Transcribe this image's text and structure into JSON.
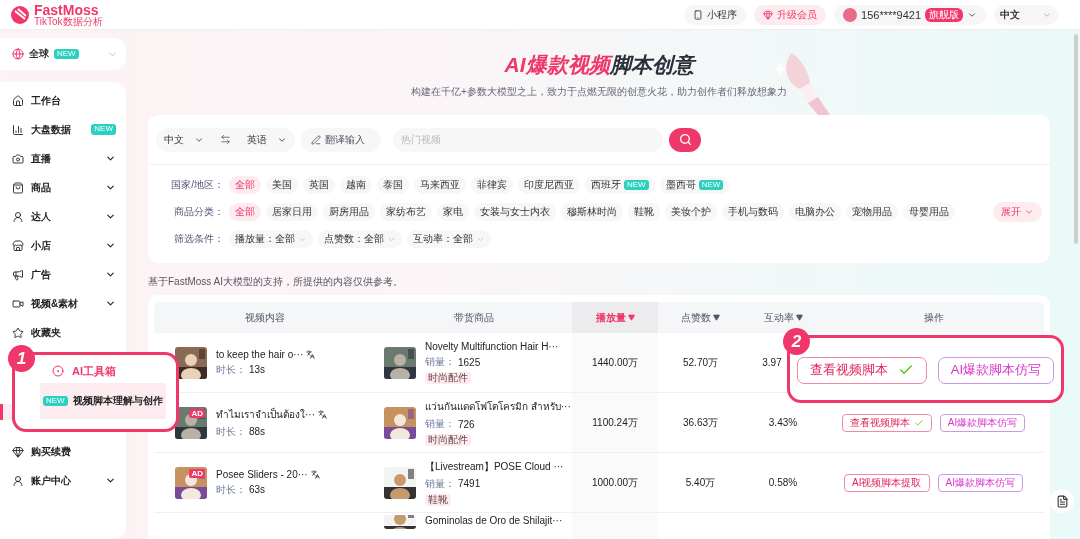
{
  "header": {
    "logo": {
      "name": "FastMoss",
      "tagline": "TikTok数据分析"
    },
    "mini_program": "小程序",
    "upgrade": "升级会员",
    "user": {
      "phone": "156****9421",
      "badge": "旗舰版"
    },
    "language": "中文"
  },
  "sidebar": {
    "region": {
      "label": "全球",
      "badge": "NEW"
    },
    "items": [
      {
        "label": "工作台",
        "expandable": false
      },
      {
        "label": "大盘数据",
        "badge": "NEW",
        "expandable": false
      },
      {
        "label": "直播",
        "expandable": true
      },
      {
        "label": "商品",
        "expandable": true
      },
      {
        "label": "达人",
        "expandable": true
      },
      {
        "label": "小店",
        "expandable": true
      },
      {
        "label": "广告",
        "expandable": true
      },
      {
        "label": "视频&素材",
        "expandable": true
      },
      {
        "label": "收藏夹",
        "expandable": false
      }
    ],
    "bottom_items": [
      {
        "label": "购买续费",
        "expandable": false
      },
      {
        "label": "账户中心",
        "expandable": true
      }
    ]
  },
  "hero": {
    "title_highlight": "AI爆款视频",
    "title_rest": "脚本创意",
    "subtitle": "构建在千亿+参数大模型之上，致力于点燃无限的创意火花，助力创作者们释放想象力"
  },
  "search": {
    "source_language": "中文",
    "target_language": "英语",
    "translate_input": "翻译输入",
    "placeholder": "热门视频"
  },
  "filters": [
    {
      "label": "国家/地区：",
      "chips": [
        {
          "label": "全部",
          "selected": true
        },
        {
          "label": "美国",
          "selected": false
        },
        {
          "label": "英国",
          "selected": false
        },
        {
          "label": "越南",
          "selected": false
        },
        {
          "label": "泰国",
          "selected": false
        },
        {
          "label": "马来西亚",
          "selected": false
        },
        {
          "label": "菲律宾",
          "selected": false
        },
        {
          "label": "印度尼西亚",
          "selected": false
        },
        {
          "label": "西班牙",
          "selected": false,
          "badge": "NEW"
        },
        {
          "label": "墨西哥",
          "selected": false,
          "badge": "NEW"
        }
      ]
    },
    {
      "label": "商品分类：",
      "chips": [
        {
          "label": "全部",
          "selected": true
        },
        {
          "label": "居家日用",
          "selected": false
        },
        {
          "label": "厨房用品",
          "selected": false
        },
        {
          "label": "家纺布艺",
          "selected": false
        },
        {
          "label": "家电",
          "selected": false
        },
        {
          "label": "女装与女士内衣",
          "selected": false
        },
        {
          "label": "穆斯林时尚",
          "selected": false
        },
        {
          "label": "鞋靴",
          "selected": false
        },
        {
          "label": "美妆个护",
          "selected": false
        },
        {
          "label": "手机与数码",
          "selected": false
        },
        {
          "label": "电脑办公",
          "selected": false
        },
        {
          "label": "宠物用品",
          "selected": false
        },
        {
          "label": "母婴用品",
          "selected": false
        }
      ],
      "more": "展开"
    }
  ],
  "conditions": {
    "label": "筛选条件：",
    "dropdowns": [
      "播放量：全部",
      "点赞数：全部",
      "互动率：全部"
    ]
  },
  "disclaimer": "基于FastMoss AI大模型的支持，所提供的内容仅供参考。",
  "table": {
    "columns": [
      {
        "label": "视频内容",
        "sortable": false,
        "selected": false
      },
      {
        "label": "带货商品",
        "sortable": false,
        "selected": false
      },
      {
        "label": "播放量",
        "sortable": true,
        "selected": true
      },
      {
        "label": "点赞数",
        "sortable": true,
        "selected": false
      },
      {
        "label": "互动率",
        "sortable": true,
        "selected": false
      },
      {
        "label": "操作",
        "sortable": false,
        "selected": false
      }
    ],
    "rows": [
      {
        "video": {
          "title": "to keep the hair o···",
          "duration_label": "时长：",
          "duration": "13s"
        },
        "product": {
          "title": "Novelty Multifunction Hair H···",
          "sales_label": "销量：",
          "sales": "1625",
          "tag": "时尚配件"
        },
        "plays": "1440.00万",
        "likes": "52.70万",
        "rate": "3.97",
        "actions": []
      },
      {
        "video": {
          "title": "ทำไมเราจำเป็นต้องใ···",
          "duration_label": "时长：",
          "duration": "88s",
          "ad_label": "AD"
        },
        "product": {
          "title": "แว่นกันแดดโฟโตโครมิก สำหรับ···",
          "sales_label": "销量：",
          "sales": "726",
          "tag": "时尚配件"
        },
        "plays": "1100.24万",
        "likes": "36.63万",
        "rate": "3.43%",
        "actions": [
          {
            "label": "查看视频脚本",
            "checked": true,
            "kind": "script"
          },
          {
            "label": "AI爆款脚本仿写",
            "checked": false,
            "kind": "imitate"
          }
        ]
      },
      {
        "video": {
          "title": "Posee Sliders - 20···",
          "duration_label": "时长：",
          "duration": "63s",
          "ad_label": "AD"
        },
        "product": {
          "title": "【Livestream】POSE Cloud ···",
          "sales_label": "销量：",
          "sales": "7491",
          "tag": "鞋靴"
        },
        "plays": "1000.00万",
        "likes": "5.40万",
        "rate": "0.58%",
        "actions": [
          {
            "label": "AI视频脚本提取",
            "checked": false,
            "kind": "script"
          },
          {
            "label": "AI爆款脚本仿写",
            "checked": false,
            "kind": "imitate"
          }
        ]
      },
      {
        "product": {
          "title": "Gominolas de Oro de Shilajit···"
        }
      }
    ]
  },
  "callouts": [
    {
      "number": "1",
      "menu_title": "AI工具箱",
      "item_badge": "NEW",
      "item_label": "视频脚本理解与创作"
    },
    {
      "number": "2",
      "actions": [
        {
          "label": "查看视频脚本",
          "checked": true,
          "kind": "script"
        },
        {
          "label": "AI爆款脚本仿写",
          "checked": false,
          "kind": "imitate"
        }
      ]
    }
  ]
}
